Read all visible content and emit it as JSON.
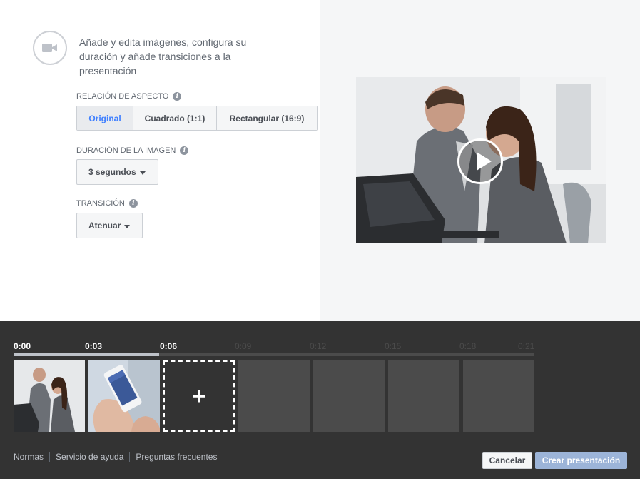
{
  "intro": {
    "text": "Añade y edita imágenes, configura su duración y añade transiciones a la presentación",
    "icon": "video-camera-icon"
  },
  "aspect_ratio": {
    "label": "RELACIÓN DE ASPECTO",
    "options": [
      "Original",
      "Cuadrado (1:1)",
      "Rectangular (16:9)"
    ],
    "selected": "Original"
  },
  "image_duration": {
    "label": "DURACIÓN DE LA IMAGEN",
    "value": "3 segundos"
  },
  "transition": {
    "label": "TRANSICIÓN",
    "value": "Atenuar"
  },
  "preview": {
    "icon": "play-icon"
  },
  "timeline": {
    "ticks": [
      "0:00",
      "0:03",
      "0:06",
      "0:09",
      "0:12",
      "0:15",
      "0:18",
      "0:21"
    ],
    "progress_fraction": 0.28,
    "add_icon": "plus-icon"
  },
  "footer": {
    "links": [
      "Normas",
      "Servicio de ayuda",
      "Preguntas frecuentes"
    ],
    "cancel_label": "Cancelar",
    "create_label": "Crear presentación"
  },
  "colors": {
    "accent": "#4080ff",
    "timeline_bg": "#333333",
    "create_button": "#9cb4d8"
  }
}
